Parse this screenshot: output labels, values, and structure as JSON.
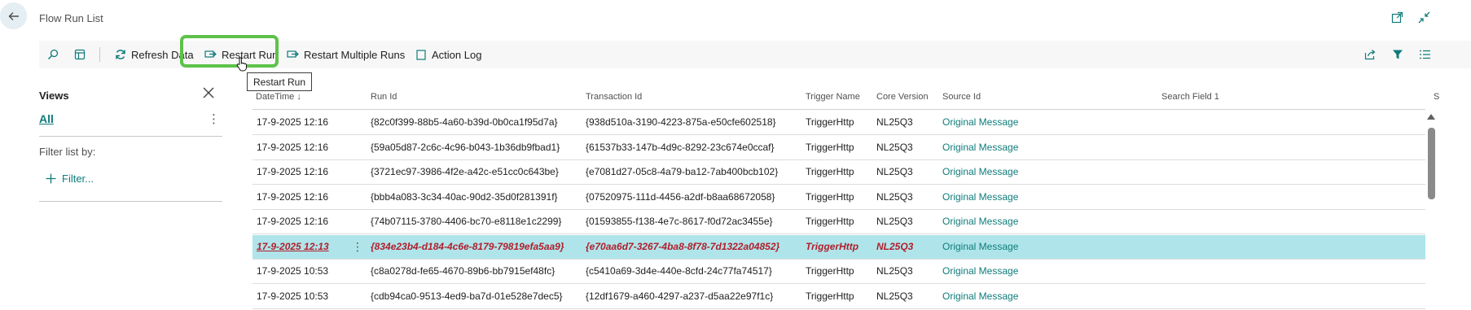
{
  "header": {
    "title": "Flow Run List"
  },
  "actionbar": {
    "refresh_label": "Refresh Data",
    "restart_label": "Restart Run",
    "restart_multiple_label": "Restart Multiple Runs",
    "action_log_label": "Action Log"
  },
  "tooltip": {
    "text": "Restart Run"
  },
  "views": {
    "title": "Views",
    "all_label": "All",
    "filter_by_label": "Filter list by:",
    "filter_link": "Filter..."
  },
  "columns": {
    "datetime": "DateTime",
    "run_id": "Run Id",
    "transaction_id": "Transaction Id",
    "trigger_name": "Trigger Name",
    "core_version": "Core Version",
    "source_id": "Source Id",
    "search_field_1": "Search Field 1",
    "cut": "S"
  },
  "sort": {
    "datetime_arrow": "↓"
  },
  "rows": [
    {
      "datetime": "17-9-2025 12:16",
      "run_id": "{82c0f399-88b5-4a60-b39d-0b0ca1f95d7a}",
      "transaction_id": "{938d510a-3190-4223-875a-e50cfe602518}",
      "trigger": "TriggerHttp",
      "core": "NL25Q3",
      "source": "Original Message"
    },
    {
      "datetime": "17-9-2025 12:16",
      "run_id": "{59a05d87-2c6c-4c96-b043-1b36db9fbad1}",
      "transaction_id": "{61537b33-147b-4d9c-8292-23c674e0ccaf}",
      "trigger": "TriggerHttp",
      "core": "NL25Q3",
      "source": "Original Message"
    },
    {
      "datetime": "17-9-2025 12:16",
      "run_id": "{3721ec97-3986-4f2e-a42c-e51cc0c643be}",
      "transaction_id": "{e7081d27-05c8-4a79-ba12-7ab400bcb102}",
      "trigger": "TriggerHttp",
      "core": "NL25Q3",
      "source": "Original Message"
    },
    {
      "datetime": "17-9-2025 12:16",
      "run_id": "{bbb4a083-3c34-40ac-90d2-35d0f281391f}",
      "transaction_id": "{07520975-111d-4456-a2df-b8aa68672058}",
      "trigger": "TriggerHttp",
      "core": "NL25Q3",
      "source": "Original Message"
    },
    {
      "datetime": "17-9-2025 12:16",
      "run_id": "{74b07115-3780-4406-bc70-e8118e1c2299}",
      "transaction_id": "{01593855-f138-4e7c-8617-f0d72ac3455e}",
      "trigger": "TriggerHttp",
      "core": "NL25Q3",
      "source": "Original Message"
    },
    {
      "datetime": "17-9-2025 12:13",
      "run_id": "{834e23b4-d184-4c6e-8179-79819efa5aa9}",
      "transaction_id": "{e70aa6d7-3267-4ba8-8f78-7d1322a04852}",
      "trigger": "TriggerHttp",
      "core": "NL25Q3",
      "source": "Original Message"
    },
    {
      "datetime": "17-9-2025 10:53",
      "run_id": "{c8a0278d-fe65-4670-89b6-bb7915ef48fc}",
      "transaction_id": "{c5410a69-3d4e-440e-8cfd-24c77fa74517}",
      "trigger": "TriggerHttp",
      "core": "NL25Q3",
      "source": "Original Message"
    },
    {
      "datetime": "17-9-2025 10:53",
      "run_id": "{cdb94ca0-9513-4ed9-ba7d-01e528e7dec5}",
      "transaction_id": "{12df1679-a460-4297-a237-d5aa22e97f1c}",
      "trigger": "TriggerHttp",
      "core": "NL25Q3",
      "source": "Original Message"
    }
  ],
  "colors": {
    "accent": "#0f7b7b",
    "selected_row": "#afe5ea",
    "error_text": "#b11e2c",
    "highlight_border": "#5dc24a"
  },
  "icons": [
    "back-arrow-icon",
    "open-in-new-window-icon",
    "collapse-icon",
    "search-icon",
    "show-as-list-icon",
    "refresh-icon",
    "restart-icon",
    "restart-multiple-icon",
    "action-log-icon",
    "share-icon",
    "filter-icon",
    "list-view-icon",
    "close-icon",
    "more-options-icon",
    "plus-icon",
    "hand-cursor-icon",
    "scroll-up-icon"
  ]
}
